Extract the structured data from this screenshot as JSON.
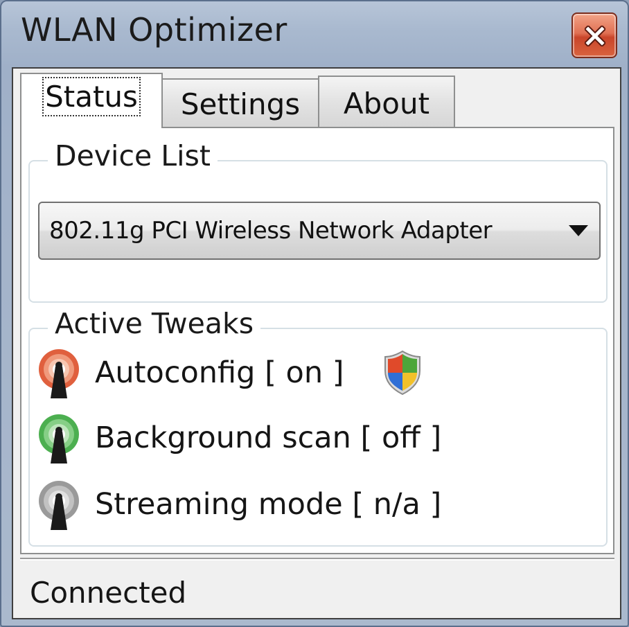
{
  "window": {
    "title": "WLAN Optimizer"
  },
  "tabs": [
    {
      "label": "Status",
      "active": true
    },
    {
      "label": "Settings",
      "active": false
    },
    {
      "label": "About",
      "active": false
    }
  ],
  "device_list": {
    "legend": "Device List",
    "selected": "802.11g PCI Wireless Network Adapter"
  },
  "active_tweaks": {
    "legend": "Active Tweaks",
    "items": [
      {
        "label": "Autoconfig [ on ]",
        "icon": "antenna-icon",
        "color": "#e0603e"
      },
      {
        "label": "Background scan [ off ]",
        "icon": "antenna-icon",
        "color": "#4caf50"
      },
      {
        "label": "Streaming mode [ n/a ]",
        "icon": "antenna-icon",
        "color": "#9a9a9a"
      }
    ],
    "elevation_icon": "uac-shield-icon"
  },
  "status": {
    "text": "Connected"
  },
  "colors": {
    "titlebar": "#a9b9cf",
    "close_button": "#d9643f",
    "panel": "#ffffff"
  }
}
